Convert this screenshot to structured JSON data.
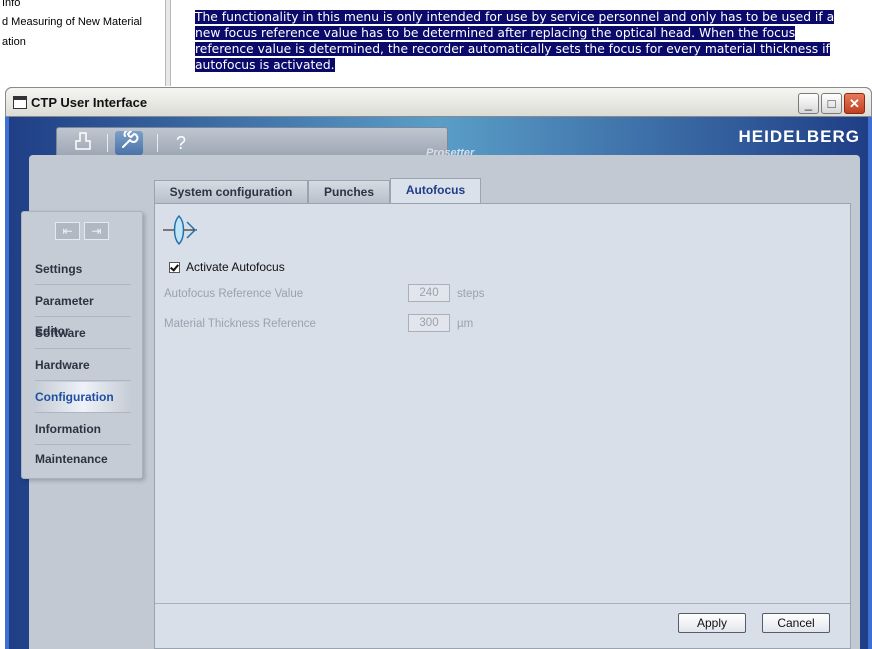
{
  "background": {
    "toc": [
      "Info",
      "d Measuring of New Material",
      "ation"
    ],
    "paragraph": "The functionality in this menu is only intended for use by service personnel and only has to be used if a new focus reference value has to be determined after replacing the optical head. When the focus reference value is determined, the recorder automatically sets the focus for every material thickness if autofocus is activated."
  },
  "window": {
    "title": "CTP User Interface",
    "brand": "HEIDELBERG",
    "product": "Prosetter"
  },
  "toolbar": {
    "icons": [
      "stamp-icon",
      "wrench-icon",
      "help-icon"
    ]
  },
  "sidebar": {
    "items": [
      {
        "label": "Settings"
      },
      {
        "label": "Parameter Editor"
      },
      {
        "label": "Software"
      },
      {
        "label": "Hardware"
      },
      {
        "label": "Configuration"
      },
      {
        "label": "Information"
      },
      {
        "label": "Maintenance"
      }
    ],
    "active": "Configuration"
  },
  "tabs": [
    {
      "label": "System configuration"
    },
    {
      "label": "Punches"
    },
    {
      "label": "Autofocus"
    }
  ],
  "active_tab": "Autofocus",
  "autofocus": {
    "activate_label": "Activate Autofocus",
    "activate_checked": true,
    "ref_label": "Autofocus Reference Value",
    "ref_value": "240",
    "ref_unit": "steps",
    "thickness_label": "Material Thickness Reference",
    "thickness_value": "300",
    "thickness_unit": "µm"
  },
  "buttons": {
    "apply": "Apply",
    "cancel": "Cancel"
  }
}
